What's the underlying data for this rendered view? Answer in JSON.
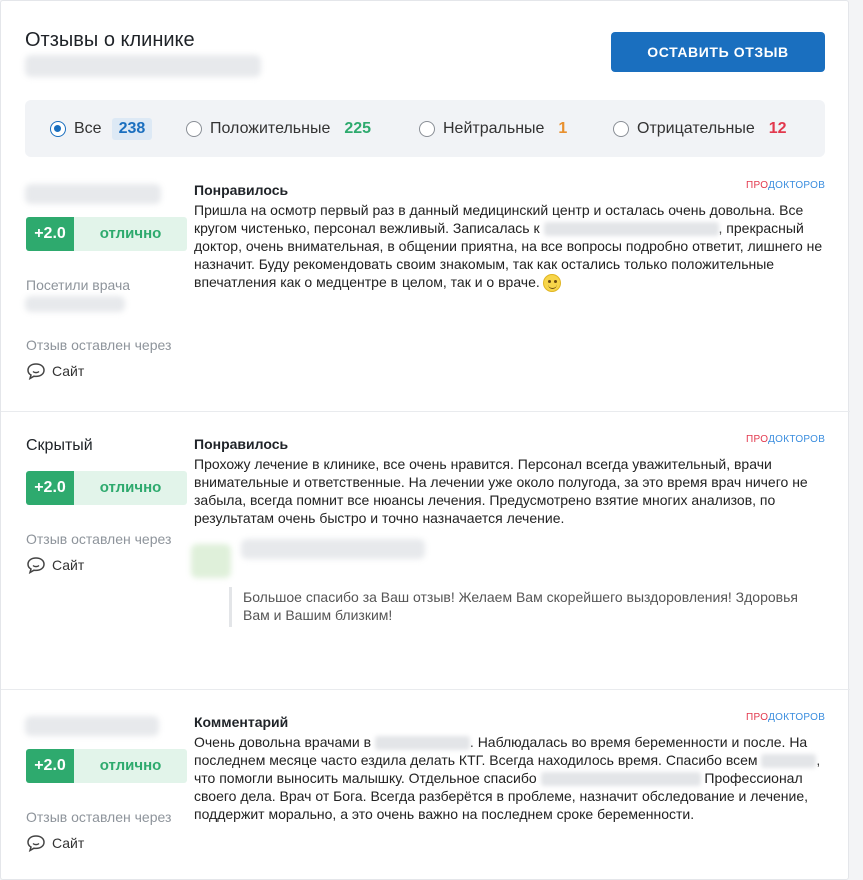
{
  "header": {
    "title": "Отзывы о клинике",
    "leave_review_label": "ОСТАВИТЬ ОТЗЫВ"
  },
  "filters": [
    {
      "label": "Все",
      "count": "238",
      "color": "#1a6fbf",
      "selected": true
    },
    {
      "label": "Положительные",
      "count": "225",
      "color": "#2eaa6e",
      "selected": false
    },
    {
      "label": "Нейтральные",
      "count": "1",
      "color": "#e8902e",
      "selected": false
    },
    {
      "label": "Отрицательные",
      "count": "12",
      "color": "#e2384d",
      "selected": false
    }
  ],
  "brand": {
    "part1": "ПРО",
    "part2": "ДОКТОРОВ"
  },
  "reviews": [
    {
      "author": "",
      "score": "+2.0",
      "score_word": "отлично",
      "visited_label": "Посетили врача",
      "via_label": "Отзыв оставлен через",
      "source": "Сайт",
      "title": "Понравилось",
      "text_a": "Пришла на осмотр первый раз в данный медицинский центр и осталась очень довольна. Все кругом чистенько, персонал вежливый. Записалась к ",
      "text_b": ", прекрасный доктор, очень внимательная, в общении приятна, на все вопросы подробно ответит, лишнего не назначит. Буду рекомендовать своим знакомым, так как остались только положительные впечатления как о медцентре в целом, так и о враче."
    },
    {
      "author": "Скрытый",
      "score": "+2.0",
      "score_word": "отлично",
      "via_label": "Отзыв оставлен через",
      "source": "Сайт",
      "title": "Понравилось",
      "text": "Прохожу лечение в клинике, все очень нравится. Персонал всегда уважительный, врачи внимательные и ответственные. На лечении уже около полугода, за это время врач ничего не забыла, всегда помнит все нюансы лечения. Предусмотрено взятие многих анализов, по результатам очень быстро и точно назначается лечение.",
      "reply": "Большое спасибо за Ваш отзыв! Желаем Вам скорейшего выздоровления! Здоровья Вам и Вашим близким!"
    },
    {
      "author": "",
      "score": "+2.0",
      "score_word": "отлично",
      "via_label": "Отзыв оставлен через",
      "source": "Сайт",
      "title": "Комментарий",
      "text_a": "Очень довольна врачами в ",
      "text_b": ". Наблюдалась во время беременности и после. На последнем месяце часто ездила делать КТГ. Всегда находилось время. Спасибо всем ",
      "text_c": ", что помогли выносить малышку. Отдельное спасибо ",
      "text_d": " Профессионал своего дела. Врач от Бога. Всегда разберётся в проблеме, назначит обследование и лечение, поддержит морально, а это очень важно на последнем сроке беременности."
    }
  ]
}
